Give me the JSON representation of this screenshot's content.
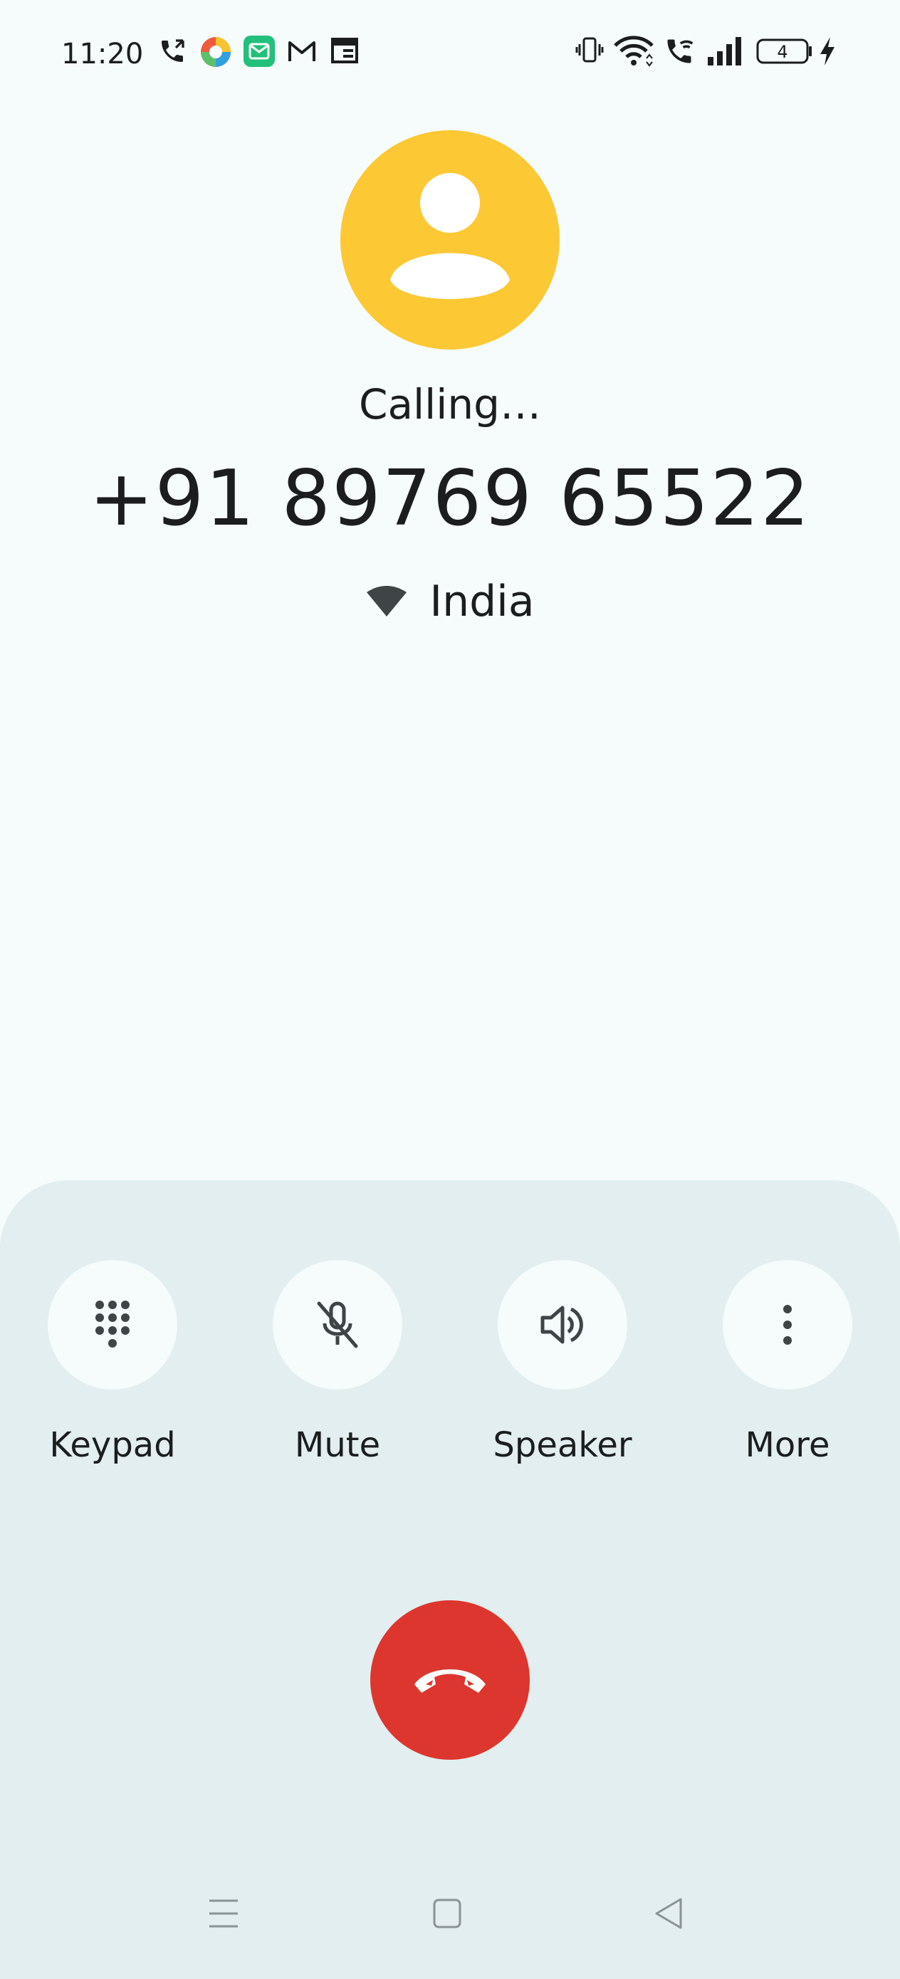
{
  "status_bar": {
    "time": "11:20",
    "battery": "4",
    "left_icons": [
      "phone-call-icon",
      "browser-app-icon",
      "email-app-icon",
      "gmail-icon",
      "calendar-icon"
    ],
    "right_icons": [
      "vibrate-icon",
      "wifi-icon",
      "wifi-calling-icon",
      "signal-icon",
      "battery-icon",
      "charging-icon"
    ]
  },
  "call": {
    "status": "Calling…",
    "number": "+91 89769 65522",
    "location": "India",
    "avatar_color": "#fcc834"
  },
  "controls": [
    {
      "label": "Keypad",
      "icon": "dialpad-icon"
    },
    {
      "label": "Mute",
      "icon": "mic-off-icon"
    },
    {
      "label": "Speaker",
      "icon": "speaker-icon"
    },
    {
      "label": "More",
      "icon": "more-vert-icon"
    }
  ],
  "end_call": {
    "icon": "call-end-icon",
    "color": "#dc362e"
  },
  "nav": {
    "icons": [
      "recents-menu-icon",
      "home-square-icon",
      "back-triangle-icon"
    ]
  }
}
